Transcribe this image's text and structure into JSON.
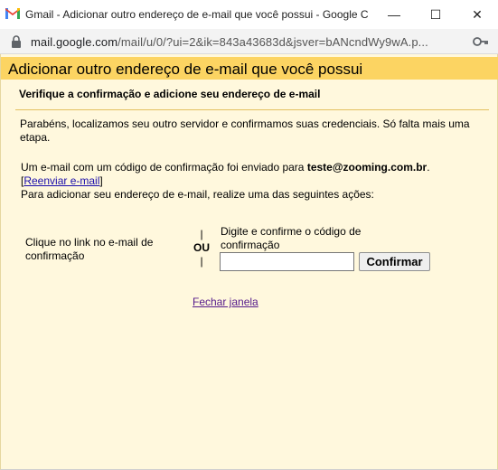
{
  "window": {
    "title": "Gmail - Adicionar outro endereço de e-mail que você possui - Google Chrome",
    "minimize_glyph": "—",
    "maximize_glyph": "☐",
    "close_glyph": "✕"
  },
  "address_bar": {
    "host": "mail.google.com",
    "path": "/mail/u/0/?ui=2&ik=843a43683d&jsver=bANcndWy9wA.p..."
  },
  "page": {
    "title": "Adicionar outro endereço de e-mail que você possui",
    "subtitle": "Verifique a confirmação e adicione seu endereço de e-mail",
    "intro": "Parabéns, localizamos seu outro servidor e confirmamos suas credenciais. Só falta mais uma etapa.",
    "sent_prefix": "Um e-mail com um código de confirmação foi enviado para",
    "email": "teste@zooming.com.br",
    "sent_suffix": ".",
    "bracket_open": "[",
    "resend_label": "Reenviar e-mail",
    "bracket_close": "]",
    "action_instruction": "Para adicionar seu endereço de e-mail, realize uma das seguintes ações:",
    "option_link": "Clique no link no e-mail de confirmação",
    "or_bar_top": "|",
    "or_label": "OU",
    "or_bar_bottom": "|",
    "option_code": "Digite e confirme o código de confirmação",
    "code_value": "",
    "confirm_label": "Confirmar",
    "close_label": "Fechar janela"
  },
  "colors": {
    "header_bg": "#fcd462",
    "page_bg": "#fff8dd",
    "link": "#1a0dab",
    "visited_link": "#551a8b"
  },
  "icons": [
    "gmail-icon",
    "lock-icon",
    "key-icon"
  ]
}
